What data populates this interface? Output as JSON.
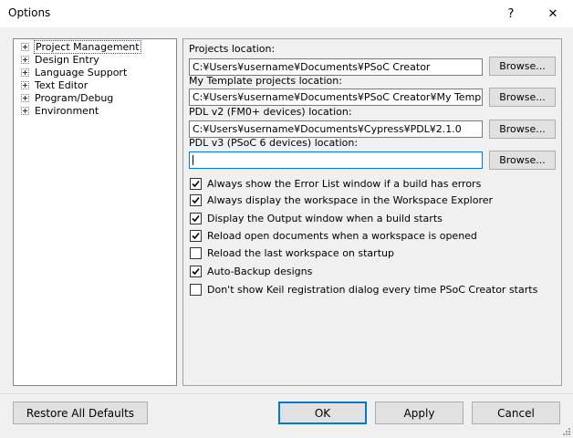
{
  "window": {
    "title": "Options",
    "help_glyph": "?",
    "close_glyph": "✕"
  },
  "tree": {
    "items": [
      {
        "label": "Project Management",
        "selected": true
      },
      {
        "label": "Design Entry"
      },
      {
        "label": "Language Support"
      },
      {
        "label": "Text Editor"
      },
      {
        "label": "Program/Debug"
      },
      {
        "label": "Environment"
      }
    ]
  },
  "locations": {
    "projects": {
      "label": "Projects location:",
      "value": "C:¥Users¥username¥Documents¥PSoC Creator"
    },
    "templates": {
      "label": "My Template projects location:",
      "value": "C:¥Users¥username¥Documents¥PSoC Creator¥My Templates"
    },
    "pdl_v2": {
      "label": "PDL v2 (FM0+ devices) location:",
      "value": "C:¥Users¥username¥Documents¥Cypress¥PDL¥2.1.0"
    },
    "pdl_v3": {
      "label": "PDL v3 (PSoC 6 devices) location:",
      "value": ""
    },
    "browse_label": "Browse..."
  },
  "options": [
    {
      "label": "Always show the Error List window if a build has errors",
      "checked": true
    },
    {
      "label": "Always display the workspace in the Workspace Explorer",
      "checked": true
    },
    {
      "label": "Display the Output window when a build starts",
      "checked": true
    },
    {
      "label": "Reload open documents when a workspace is opened",
      "checked": true
    },
    {
      "label": "Reload the last workspace on startup",
      "checked": false
    },
    {
      "label": "Auto-Backup designs",
      "checked": true
    },
    {
      "label": "Don't show Keil registration dialog every time PSoC Creator starts",
      "checked": false
    }
  ],
  "buttons": {
    "restore": "Restore All Defaults",
    "ok": "OK",
    "apply": "Apply",
    "cancel": "Cancel"
  }
}
